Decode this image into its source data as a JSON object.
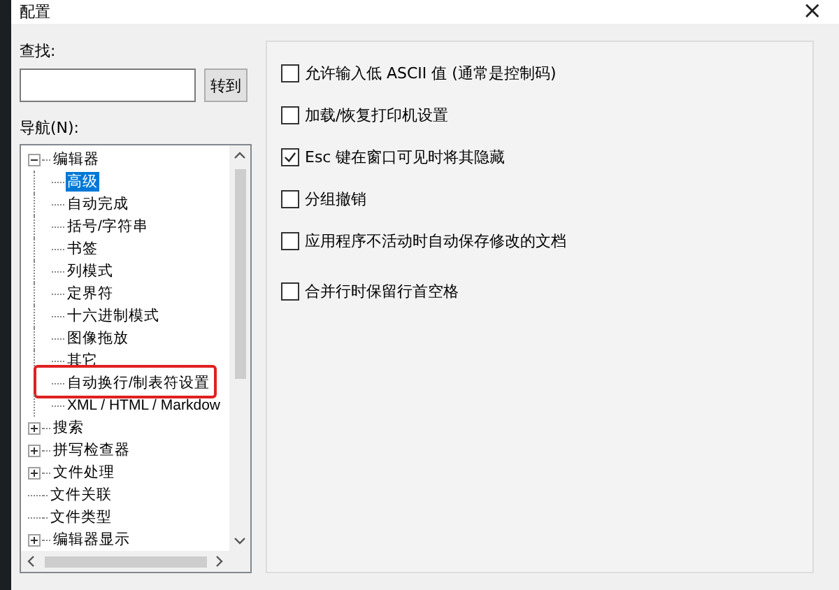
{
  "window": {
    "title": "配置",
    "close": "×"
  },
  "search": {
    "label": "查找:",
    "button": "转到"
  },
  "navigation": {
    "label": "导航(N):",
    "items": [
      {
        "label": "编辑器",
        "expanded": true,
        "selected": false,
        "children": [
          {
            "label": "高级",
            "selected": true,
            "highlighted": false
          },
          {
            "label": "自动完成",
            "selected": false,
            "highlighted": false
          },
          {
            "label": "括号/字符串",
            "selected": false,
            "highlighted": false
          },
          {
            "label": "书签",
            "selected": false,
            "highlighted": false
          },
          {
            "label": "列模式",
            "selected": false,
            "highlighted": false
          },
          {
            "label": "定界符",
            "selected": false,
            "highlighted": false
          },
          {
            "label": "十六进制模式",
            "selected": false,
            "highlighted": false
          },
          {
            "label": "图像拖放",
            "selected": false,
            "highlighted": false
          },
          {
            "label": "其它",
            "selected": false,
            "highlighted": false
          },
          {
            "label": "自动换行/制表符设置",
            "selected": false,
            "highlighted": true
          },
          {
            "label": "XML / HTML / Markdow",
            "selected": false,
            "highlighted": false
          }
        ]
      },
      {
        "label": "搜索",
        "expanded": false,
        "selected": false
      },
      {
        "label": "拼写检查器",
        "expanded": false,
        "selected": false
      },
      {
        "label": "文件处理",
        "expanded": false,
        "selected": false
      },
      {
        "label": "文件关联",
        "selected": false
      },
      {
        "label": "文件类型",
        "selected": false
      },
      {
        "label": "编辑器显示",
        "expanded": false,
        "selected": false
      }
    ]
  },
  "options": [
    {
      "label": "允许输入低 ASCII 值 (通常是控制码)",
      "checked": false
    },
    {
      "label": "加载/恢复打印机设置",
      "checked": false
    },
    {
      "label": "Esc 键在窗口可见时将其隐藏",
      "checked": true
    },
    {
      "label": "分组撤销",
      "checked": false
    },
    {
      "label": "应用程序不活动时自动保存修改的文档",
      "checked": false
    },
    {
      "label": "合并行时保留行首空格",
      "checked": false
    }
  ]
}
